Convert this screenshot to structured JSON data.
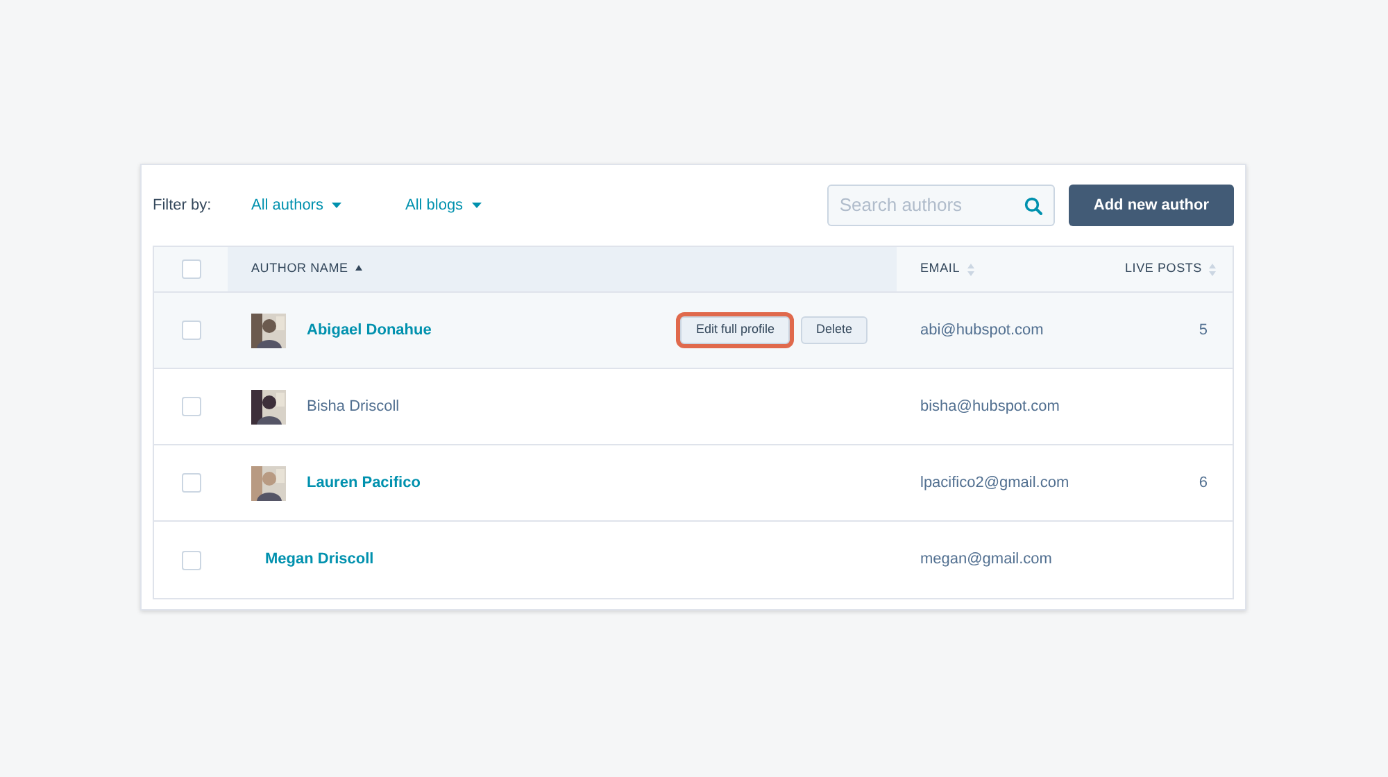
{
  "filters": {
    "label": "Filter by:",
    "dropdowns": [
      "All authors",
      "All blogs"
    ]
  },
  "search": {
    "placeholder": "Search authors"
  },
  "add_button": "Add new author",
  "table": {
    "all_checked": false,
    "columns": [
      {
        "label": "AUTHOR NAME",
        "sorted": true
      },
      {
        "label": "EMAIL",
        "sorted": false
      },
      {
        "label": "LIVE POSTS",
        "sorted": false
      }
    ],
    "rows": [
      {
        "checked": false,
        "name": "Abigael Donahue",
        "linked": true,
        "photo": true,
        "hovered": true,
        "actions": [
          "Edit full profile",
          "Delete"
        ],
        "email": "abi@hubspot.com",
        "live_posts": "5"
      },
      {
        "checked": false,
        "name": "Bisha Driscoll",
        "linked": false,
        "photo": true,
        "hovered": false,
        "email": "bisha@hubspot.com"
      },
      {
        "checked": false,
        "name": "Lauren Pacifico",
        "linked": true,
        "photo": true,
        "hovered": false,
        "email": "lpacifico2@gmail.com",
        "live_posts": "6"
      },
      {
        "checked": false,
        "name": "Megan Driscoll",
        "linked": true,
        "photo": false,
        "hovered": false,
        "email": "megan@gmail.com"
      }
    ]
  }
}
